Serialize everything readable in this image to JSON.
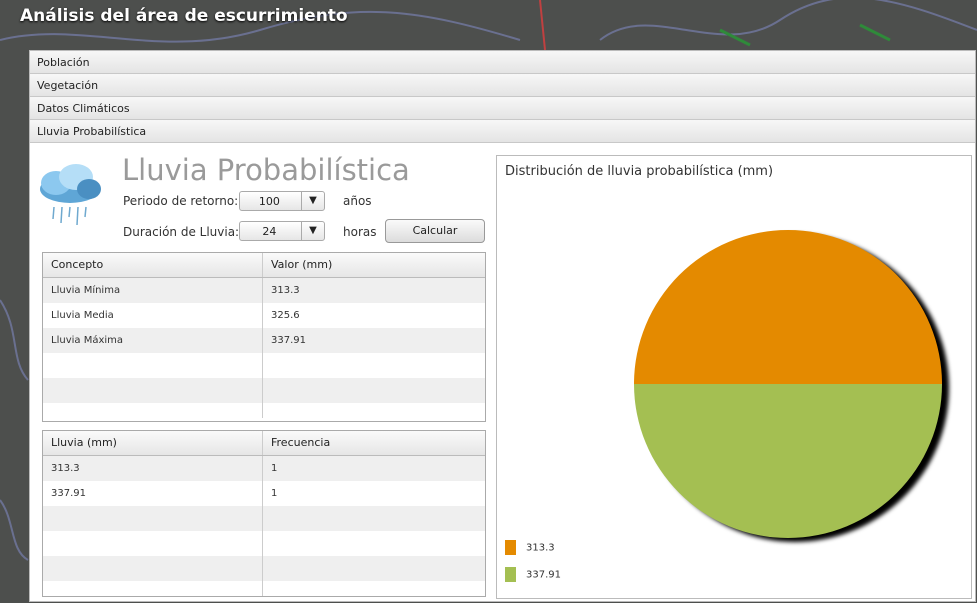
{
  "window": {
    "title": "Análisis del área de escurrimiento"
  },
  "accordion": [
    "Población",
    "Vegetación",
    "Datos Climáticos",
    "Lluvia Probabilística"
  ],
  "main": {
    "title": "Lluvia Probabilística",
    "periodo_label": "Periodo de retorno:",
    "periodo_value": "100",
    "periodo_unit": "años",
    "duracion_label": "Duración de Lluvia:",
    "duracion_value": "24",
    "duracion_unit": "horas",
    "calc_label": "Calcular"
  },
  "table1": {
    "headers": [
      "Concepto",
      "Valor (mm)"
    ],
    "rows": [
      [
        "Lluvia Mínima",
        "313.3"
      ],
      [
        "Lluvia Media",
        "325.6"
      ],
      [
        "Lluvia Máxima",
        "337.91"
      ]
    ]
  },
  "table2": {
    "headers": [
      "Lluvia (mm)",
      "Frecuencia"
    ],
    "rows": [
      [
        "313.3",
        "1"
      ],
      [
        "337.91",
        "1"
      ]
    ]
  },
  "chart_data": {
    "type": "pie",
    "title": "Distribución de lluvia probabilística (mm)",
    "labels": [
      "313.3",
      "337.91"
    ],
    "values": [
      1,
      1
    ],
    "colors": [
      "#e48a00",
      "#a4bf52"
    ],
    "legend": "bottom-left"
  }
}
